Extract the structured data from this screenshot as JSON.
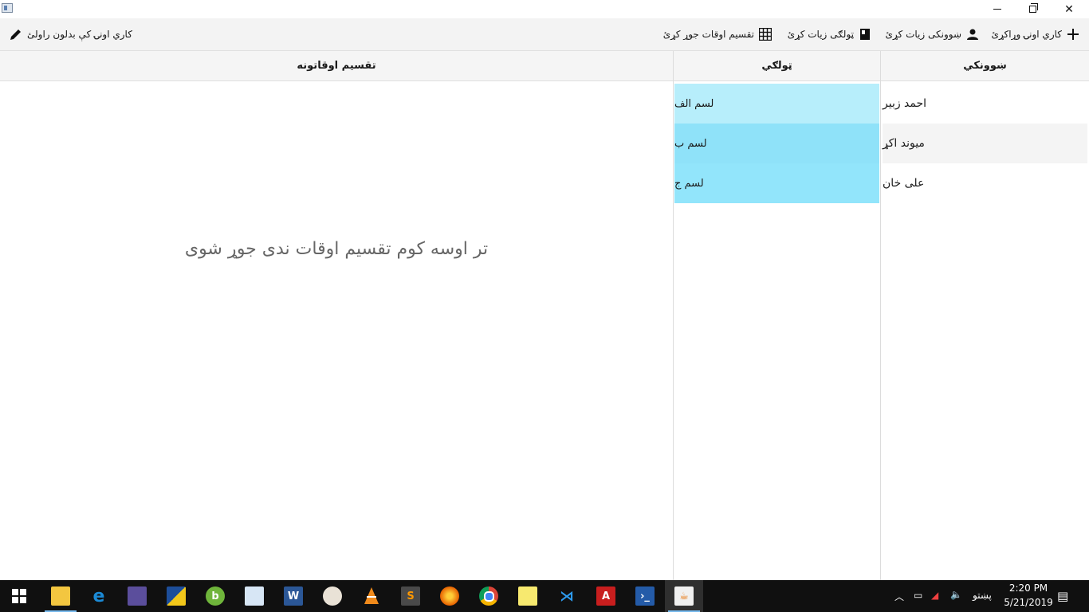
{
  "window": {
    "minimize_icon": "minimize-icon",
    "maximize_icon": "restore-icon",
    "close_glyph": "✕"
  },
  "toolbar": {
    "add_label": "كاري اونۍ وړاكړئ",
    "add_student_label": "ښوونكى زيات كړئ",
    "add_class_label": "ټولګی زيات كړئ",
    "add_schedule_label": "تقسيم اوقات جوړ كړئ",
    "edit_label": "كاري اونۍ كې بدلون راولئ"
  },
  "headers": {
    "students": "ښوونكي",
    "classes": "ټولګي",
    "schedules": "تقسيم اوقاتونه"
  },
  "students": [
    "احمد زبير",
    "ميوند اكړ",
    "علی خان"
  ],
  "classes": [
    "لسم الف",
    "لسم ب",
    "لسم ج"
  ],
  "schedules_empty": "تر اوسه كوم تقسيم اوقات ندی جوړ شوی",
  "colors": {
    "accent_light": "#b7eefb",
    "accent": "#8fe2f9"
  },
  "taskbar": {
    "apps": [
      "start-icon",
      "file-explorer-icon",
      "edge-icon",
      "app-icon",
      "app-icon",
      "app-icon",
      "app-icon",
      "word-icon",
      "paint-icon",
      "vlc-icon",
      "sublime-icon",
      "firefox-icon",
      "chrome-icon",
      "sticky-notes-icon",
      "vscode-icon",
      "acrobat-icon",
      "powershell-icon",
      "java-icon"
    ],
    "language": "پښتو",
    "time": "2:20 PM",
    "date": "5/21/2019"
  }
}
